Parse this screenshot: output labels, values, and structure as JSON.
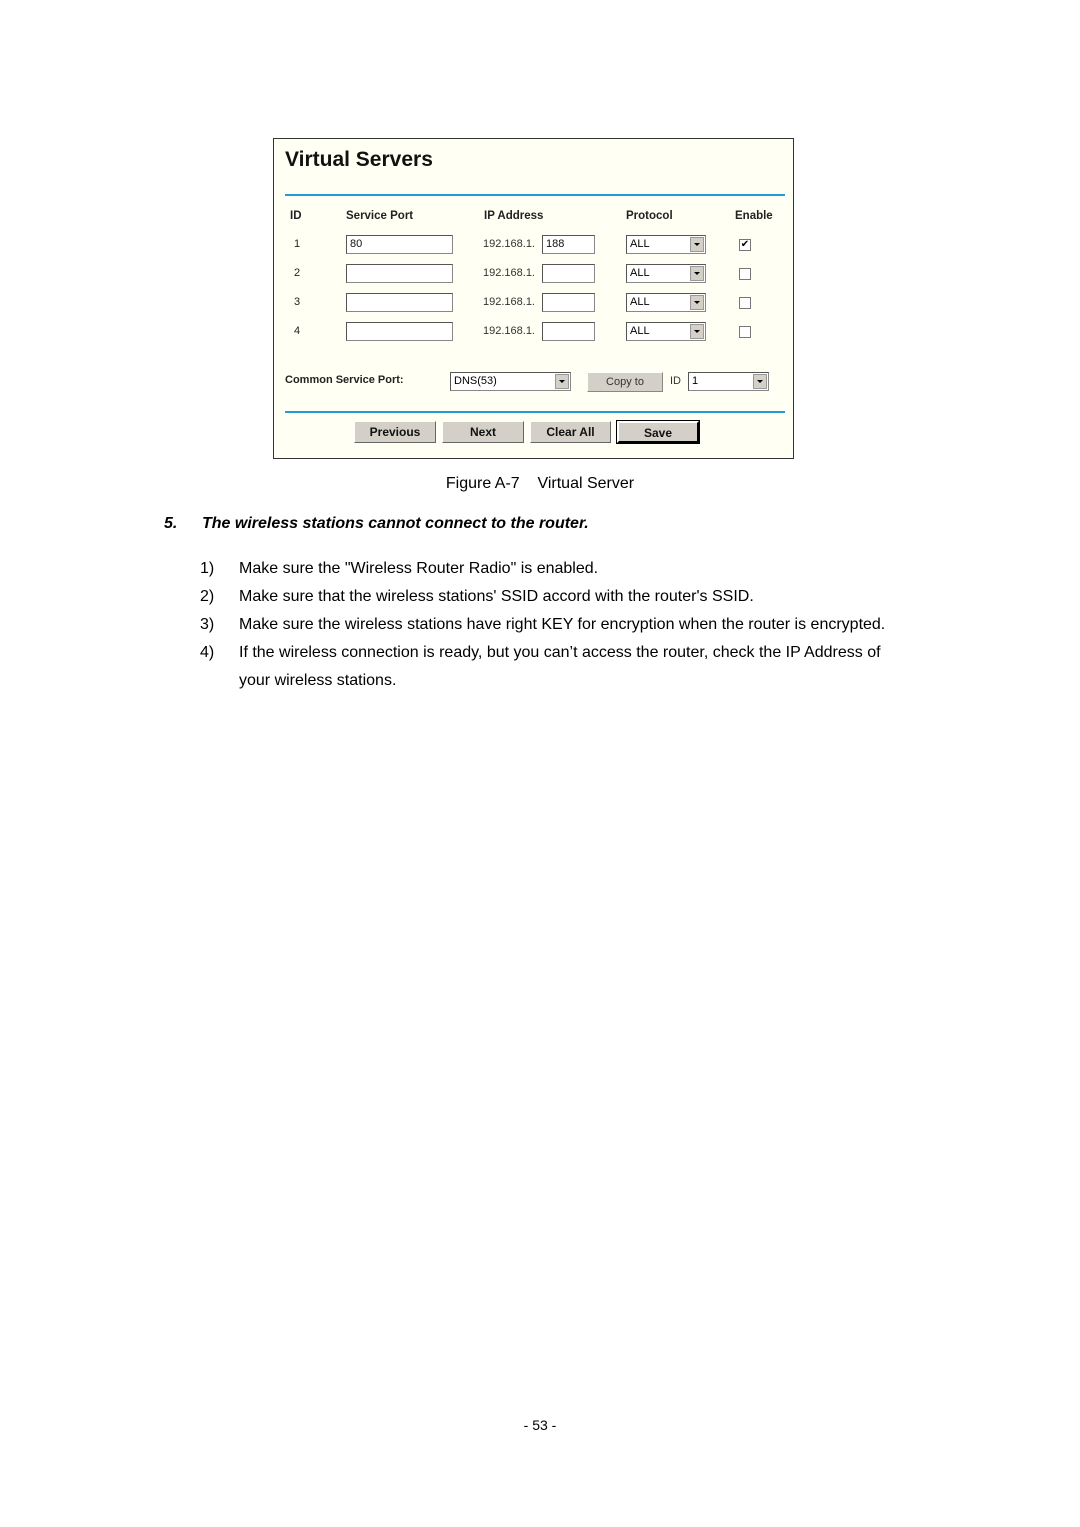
{
  "figure": {
    "title": "Virtual Servers",
    "columns": [
      "ID",
      "Service Port",
      "IP Address",
      "Protocol",
      "Enable"
    ],
    "rows": [
      {
        "id": "1",
        "service_port": "80",
        "ip_prefix": "192.168.1.",
        "ip_last": "188",
        "protocol": "ALL",
        "enabled": "✔"
      },
      {
        "id": "2",
        "service_port": "",
        "ip_prefix": "192.168.1.",
        "ip_last": "",
        "protocol": "ALL",
        "enabled": ""
      },
      {
        "id": "3",
        "service_port": "",
        "ip_prefix": "192.168.1.",
        "ip_last": "",
        "protocol": "ALL",
        "enabled": ""
      },
      {
        "id": "4",
        "service_port": "",
        "ip_prefix": "192.168.1.",
        "ip_last": "",
        "protocol": "ALL",
        "enabled": ""
      }
    ],
    "common_service_port": {
      "label": "Common Service Port:",
      "selected": "DNS(53)",
      "copy_button": "Copy to",
      "id_label": "ID",
      "id_selected": "1"
    },
    "buttons": {
      "previous": "Previous",
      "next": "Next",
      "clear_all": "Clear All",
      "save": "Save"
    },
    "colors": {
      "accent_line": "#1e9ed6",
      "panel_bg": "#fffff4"
    }
  },
  "caption": "Figure A-7    Virtual Server",
  "section": {
    "number": "5.",
    "heading": "The wireless stations cannot connect to the router."
  },
  "items": [
    {
      "n": "1)",
      "text": "Make sure the \"Wireless Router Radio\" is enabled."
    },
    {
      "n": "2)",
      "text": "Make sure that the wireless stations' SSID accord with the router's SSID."
    },
    {
      "n": "3)",
      "text": "Make sure the wireless stations have right KEY for encryption when the router is encrypted."
    },
    {
      "n": "4)",
      "text": "If the wireless connection is ready, but you can’t access the router, check the IP Address of your wireless stations."
    }
  ],
  "page_number": "- 53 -"
}
